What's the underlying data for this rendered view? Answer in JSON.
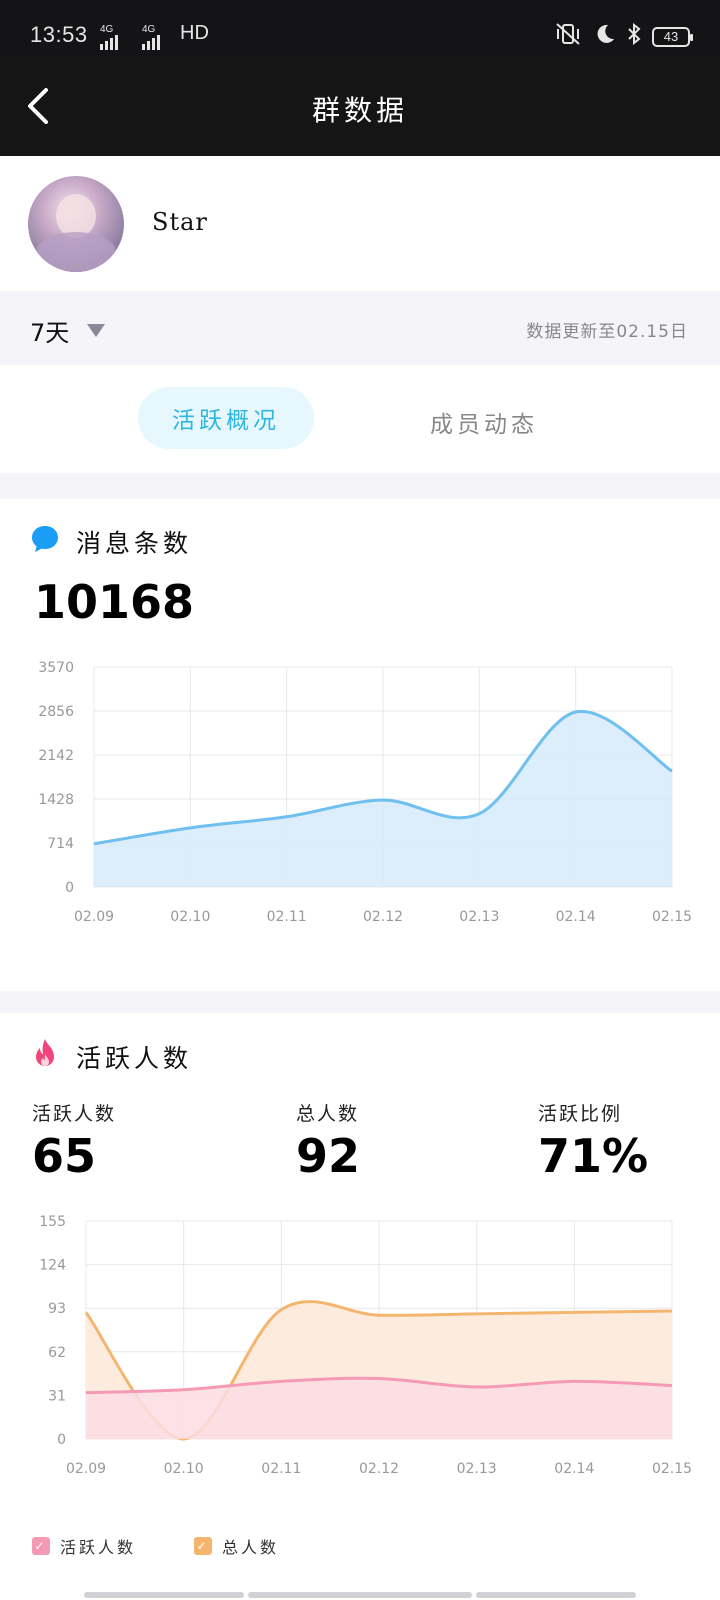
{
  "status_bar": {
    "time": "13:53",
    "network1": "4G",
    "network2": "4G",
    "hd": "HD",
    "battery": "43"
  },
  "nav": {
    "title": "群数据"
  },
  "profile": {
    "name": "Star"
  },
  "filter": {
    "period": "7天",
    "updated": "数据更新至02.15日"
  },
  "tabs": {
    "active": "活跃概况",
    "inactive": "成员动态"
  },
  "messages": {
    "title": "消息条数",
    "total": "10168",
    "icon": "chat-bubble-icon",
    "color": "#1a9df5"
  },
  "active": {
    "title": "活跃人数",
    "icon": "flame-icon",
    "stats": [
      {
        "label": "活跃人数",
        "value": "65"
      },
      {
        "label": "总人数",
        "value": "92"
      },
      {
        "label": "活跃比例",
        "value": "71%"
      }
    ],
    "legend": [
      {
        "label": "活跃人数",
        "color": "#f59ab5"
      },
      {
        "label": "总人数",
        "color": "#f4b66f"
      }
    ]
  },
  "chart_data": [
    {
      "type": "area",
      "x": [
        "02.09",
        "02.10",
        "02.11",
        "02.12",
        "02.13",
        "02.14",
        "02.15"
      ],
      "y_ticks": [
        0,
        714,
        1428,
        2142,
        2856,
        3570
      ],
      "ylim": [
        0,
        3570
      ],
      "series": [
        {
          "values": [
            700,
            960,
            1140,
            1410,
            1190,
            2840,
            1880
          ],
          "color": "#6fbfef",
          "fill": "#d6ebfb"
        }
      ],
      "grid": true
    },
    {
      "type": "area",
      "x": [
        "02.09",
        "02.10",
        "02.11",
        "02.12",
        "02.13",
        "02.14",
        "02.15"
      ],
      "y_ticks": [
        0,
        31,
        62,
        93,
        124,
        155
      ],
      "ylim": [
        0,
        155
      ],
      "series": [
        {
          "name": "活跃人数",
          "values": [
            33,
            35,
            41,
            43,
            37,
            41,
            38
          ],
          "color": "#f59ab5",
          "fill": "#fcdde3"
        },
        {
          "name": "总人数",
          "values": [
            90,
            0,
            92,
            88,
            89,
            90,
            91
          ],
          "color": "#f4b66f",
          "fill": "#fde9d8"
        }
      ],
      "grid": true,
      "legend": "bottom-left"
    }
  ]
}
